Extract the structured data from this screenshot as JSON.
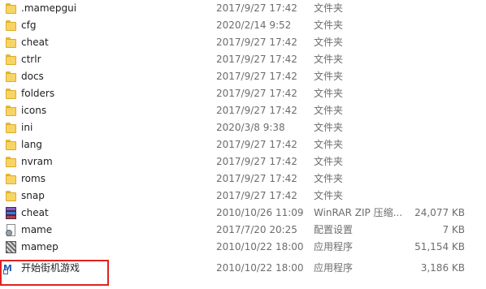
{
  "files": [
    {
      "name": ".mamepgui",
      "date": "2017/9/27 17:42",
      "type": "文件夹",
      "size": "",
      "icon": "folder-icon"
    },
    {
      "name": "cfg",
      "date": "2020/2/14 9:52",
      "type": "文件夹",
      "size": "",
      "icon": "folder-icon"
    },
    {
      "name": "cheat",
      "date": "2017/9/27 17:42",
      "type": "文件夹",
      "size": "",
      "icon": "folder-icon"
    },
    {
      "name": "ctrlr",
      "date": "2017/9/27 17:42",
      "type": "文件夹",
      "size": "",
      "icon": "folder-icon"
    },
    {
      "name": "docs",
      "date": "2017/9/27 17:42",
      "type": "文件夹",
      "size": "",
      "icon": "folder-icon"
    },
    {
      "name": "folders",
      "date": "2017/9/27 17:42",
      "type": "文件夹",
      "size": "",
      "icon": "folder-icon"
    },
    {
      "name": "icons",
      "date": "2017/9/27 17:42",
      "type": "文件夹",
      "size": "",
      "icon": "folder-icon"
    },
    {
      "name": "ini",
      "date": "2020/3/8 9:38",
      "type": "文件夹",
      "size": "",
      "icon": "folder-icon"
    },
    {
      "name": "lang",
      "date": "2017/9/27 17:42",
      "type": "文件夹",
      "size": "",
      "icon": "folder-icon"
    },
    {
      "name": "nvram",
      "date": "2017/9/27 17:42",
      "type": "文件夹",
      "size": "",
      "icon": "folder-icon"
    },
    {
      "name": "roms",
      "date": "2017/9/27 17:42",
      "type": "文件夹",
      "size": "",
      "icon": "folder-icon"
    },
    {
      "name": "snap",
      "date": "2017/9/27 17:42",
      "type": "文件夹",
      "size": "",
      "icon": "folder-icon"
    },
    {
      "name": "cheat",
      "date": "2010/10/26 11:09",
      "type": "WinRAR ZIP 压缩...",
      "size": "24,077 KB",
      "icon": "winrar-archive-icon"
    },
    {
      "name": "mame",
      "date": "2017/7/20 20:25",
      "type": "配置设置",
      "size": "7 KB",
      "icon": "config-file-icon"
    },
    {
      "name": "mamep",
      "date": "2010/10/22 18:00",
      "type": "应用程序",
      "size": "51,154 KB",
      "icon": "application-icon"
    },
    {
      "name": "开始街机游戏",
      "date": "2010/10/22 18:00",
      "type": "应用程序",
      "size": "3,186 KB",
      "icon": "shortcut-icon"
    }
  ],
  "shortcut_icon_text": "M",
  "highlight_color": "#e0221e"
}
